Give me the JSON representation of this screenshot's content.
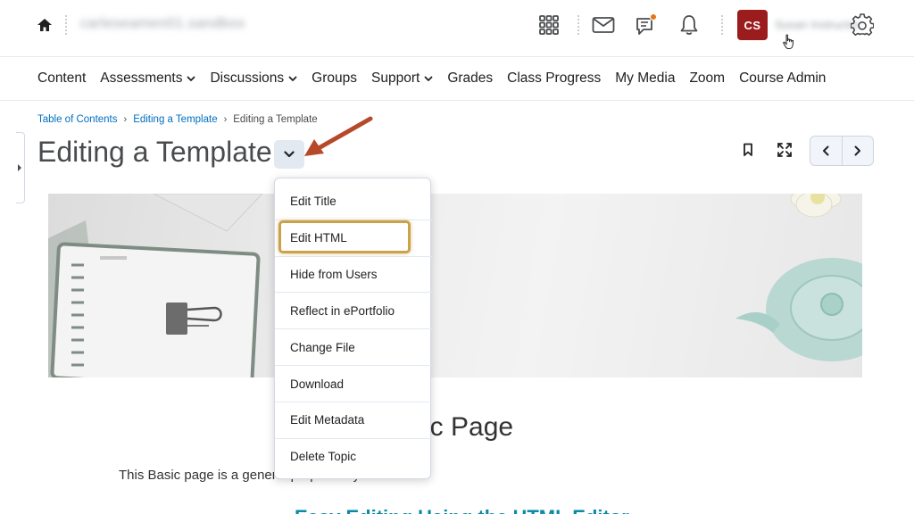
{
  "header": {
    "org_name": "carleseamen01.sandbox",
    "user_initials": "CS",
    "user_name": "Susan Instructor",
    "icons": [
      "home-icon",
      "waffle-grid-icon",
      "mail-icon",
      "chat-icon",
      "bell-icon",
      "gear-icon"
    ],
    "notification_color": "#e87511",
    "avatar_color": "#9b1c1c"
  },
  "nav": {
    "items": [
      {
        "label": "Content",
        "has_menu": false
      },
      {
        "label": "Assessments",
        "has_menu": true
      },
      {
        "label": "Discussions",
        "has_menu": true
      },
      {
        "label": "Groups",
        "has_menu": false
      },
      {
        "label": "Support",
        "has_menu": true
      },
      {
        "label": "Grades",
        "has_menu": false
      },
      {
        "label": "Class Progress",
        "has_menu": false
      },
      {
        "label": "My Media",
        "has_menu": false
      },
      {
        "label": "Zoom",
        "has_menu": false
      },
      {
        "label": "Course Admin",
        "has_menu": false
      }
    ]
  },
  "breadcrumb": {
    "items": [
      "Table of Contents",
      "Editing a Template"
    ],
    "current": "Editing a Template"
  },
  "page": {
    "title": "Editing a Template"
  },
  "menu": {
    "items": [
      "Edit Title",
      "Edit HTML",
      "Hide from Users",
      "Reflect in ePortfolio",
      "Change File",
      "Download",
      "Edit Metadata",
      "Delete Topic"
    ],
    "highlighted": "Edit HTML",
    "highlight_color": "#c9a24a"
  },
  "content": {
    "heading_visible": "sic Page",
    "text_visible": "This Basic page is a general purpose layout.",
    "link_partial": "Easy Editing Using the HTML Editor"
  },
  "annotation": {
    "arrow_color": "#b5492a"
  }
}
